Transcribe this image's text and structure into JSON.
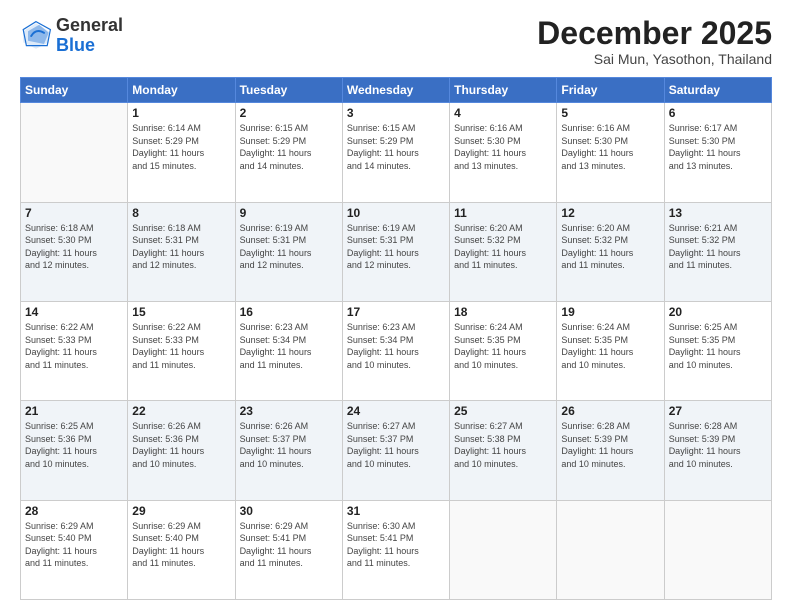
{
  "header": {
    "logo_general": "General",
    "logo_blue": "Blue",
    "month_title": "December 2025",
    "subtitle": "Sai Mun, Yasothon, Thailand"
  },
  "weekdays": [
    "Sunday",
    "Monday",
    "Tuesday",
    "Wednesday",
    "Thursday",
    "Friday",
    "Saturday"
  ],
  "weeks": [
    [
      {
        "day": "",
        "info": ""
      },
      {
        "day": "1",
        "info": "Sunrise: 6:14 AM\nSunset: 5:29 PM\nDaylight: 11 hours\nand 15 minutes."
      },
      {
        "day": "2",
        "info": "Sunrise: 6:15 AM\nSunset: 5:29 PM\nDaylight: 11 hours\nand 14 minutes."
      },
      {
        "day": "3",
        "info": "Sunrise: 6:15 AM\nSunset: 5:29 PM\nDaylight: 11 hours\nand 14 minutes."
      },
      {
        "day": "4",
        "info": "Sunrise: 6:16 AM\nSunset: 5:30 PM\nDaylight: 11 hours\nand 13 minutes."
      },
      {
        "day": "5",
        "info": "Sunrise: 6:16 AM\nSunset: 5:30 PM\nDaylight: 11 hours\nand 13 minutes."
      },
      {
        "day": "6",
        "info": "Sunrise: 6:17 AM\nSunset: 5:30 PM\nDaylight: 11 hours\nand 13 minutes."
      }
    ],
    [
      {
        "day": "7",
        "info": "Sunrise: 6:18 AM\nSunset: 5:30 PM\nDaylight: 11 hours\nand 12 minutes."
      },
      {
        "day": "8",
        "info": "Sunrise: 6:18 AM\nSunset: 5:31 PM\nDaylight: 11 hours\nand 12 minutes."
      },
      {
        "day": "9",
        "info": "Sunrise: 6:19 AM\nSunset: 5:31 PM\nDaylight: 11 hours\nand 12 minutes."
      },
      {
        "day": "10",
        "info": "Sunrise: 6:19 AM\nSunset: 5:31 PM\nDaylight: 11 hours\nand 12 minutes."
      },
      {
        "day": "11",
        "info": "Sunrise: 6:20 AM\nSunset: 5:32 PM\nDaylight: 11 hours\nand 11 minutes."
      },
      {
        "day": "12",
        "info": "Sunrise: 6:20 AM\nSunset: 5:32 PM\nDaylight: 11 hours\nand 11 minutes."
      },
      {
        "day": "13",
        "info": "Sunrise: 6:21 AM\nSunset: 5:32 PM\nDaylight: 11 hours\nand 11 minutes."
      }
    ],
    [
      {
        "day": "14",
        "info": "Sunrise: 6:22 AM\nSunset: 5:33 PM\nDaylight: 11 hours\nand 11 minutes."
      },
      {
        "day": "15",
        "info": "Sunrise: 6:22 AM\nSunset: 5:33 PM\nDaylight: 11 hours\nand 11 minutes."
      },
      {
        "day": "16",
        "info": "Sunrise: 6:23 AM\nSunset: 5:34 PM\nDaylight: 11 hours\nand 11 minutes."
      },
      {
        "day": "17",
        "info": "Sunrise: 6:23 AM\nSunset: 5:34 PM\nDaylight: 11 hours\nand 10 minutes."
      },
      {
        "day": "18",
        "info": "Sunrise: 6:24 AM\nSunset: 5:35 PM\nDaylight: 11 hours\nand 10 minutes."
      },
      {
        "day": "19",
        "info": "Sunrise: 6:24 AM\nSunset: 5:35 PM\nDaylight: 11 hours\nand 10 minutes."
      },
      {
        "day": "20",
        "info": "Sunrise: 6:25 AM\nSunset: 5:35 PM\nDaylight: 11 hours\nand 10 minutes."
      }
    ],
    [
      {
        "day": "21",
        "info": "Sunrise: 6:25 AM\nSunset: 5:36 PM\nDaylight: 11 hours\nand 10 minutes."
      },
      {
        "day": "22",
        "info": "Sunrise: 6:26 AM\nSunset: 5:36 PM\nDaylight: 11 hours\nand 10 minutes."
      },
      {
        "day": "23",
        "info": "Sunrise: 6:26 AM\nSunset: 5:37 PM\nDaylight: 11 hours\nand 10 minutes."
      },
      {
        "day": "24",
        "info": "Sunrise: 6:27 AM\nSunset: 5:37 PM\nDaylight: 11 hours\nand 10 minutes."
      },
      {
        "day": "25",
        "info": "Sunrise: 6:27 AM\nSunset: 5:38 PM\nDaylight: 11 hours\nand 10 minutes."
      },
      {
        "day": "26",
        "info": "Sunrise: 6:28 AM\nSunset: 5:39 PM\nDaylight: 11 hours\nand 10 minutes."
      },
      {
        "day": "27",
        "info": "Sunrise: 6:28 AM\nSunset: 5:39 PM\nDaylight: 11 hours\nand 10 minutes."
      }
    ],
    [
      {
        "day": "28",
        "info": "Sunrise: 6:29 AM\nSunset: 5:40 PM\nDaylight: 11 hours\nand 11 minutes."
      },
      {
        "day": "29",
        "info": "Sunrise: 6:29 AM\nSunset: 5:40 PM\nDaylight: 11 hours\nand 11 minutes."
      },
      {
        "day": "30",
        "info": "Sunrise: 6:29 AM\nSunset: 5:41 PM\nDaylight: 11 hours\nand 11 minutes."
      },
      {
        "day": "31",
        "info": "Sunrise: 6:30 AM\nSunset: 5:41 PM\nDaylight: 11 hours\nand 11 minutes."
      },
      {
        "day": "",
        "info": ""
      },
      {
        "day": "",
        "info": ""
      },
      {
        "day": "",
        "info": ""
      }
    ]
  ]
}
